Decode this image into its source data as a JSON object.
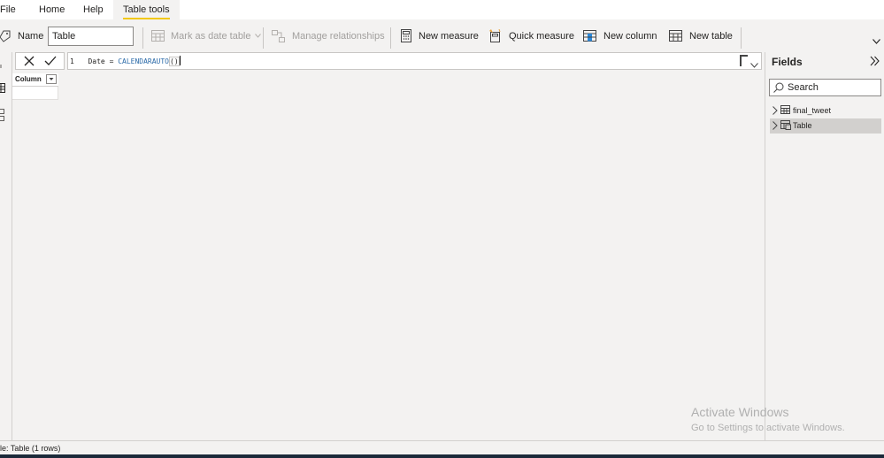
{
  "menu": {
    "file": "File",
    "home": "Home",
    "help": "Help",
    "table_tools": "Table tools"
  },
  "ribbon": {
    "name_label": "Name",
    "name_value": "Table",
    "mark_as_date_table": "Mark as date table",
    "manage_relationships": "Manage relationships",
    "new_measure": "New measure",
    "quick_measure": "Quick measure",
    "new_column": "New column",
    "new_table": "New table"
  },
  "formula": {
    "line_number": "1",
    "prefix": "Date = ",
    "function": "CALENDARAUTO",
    "parens": "()"
  },
  "grid": {
    "columns": [
      "Column"
    ]
  },
  "fields": {
    "title": "Fields",
    "search_placeholder": "Search",
    "tables": [
      "final_tweet",
      "Table"
    ],
    "selected_table": "Table"
  },
  "status": {
    "text": "le: Table (1 rows)"
  },
  "watermark": {
    "line1": "Activate Windows",
    "line2": "Go to Settings to activate Windows."
  },
  "colors": {
    "accent": "#f2c811",
    "function_blue": "#2b6aa8",
    "background": "#f3f2f1"
  }
}
